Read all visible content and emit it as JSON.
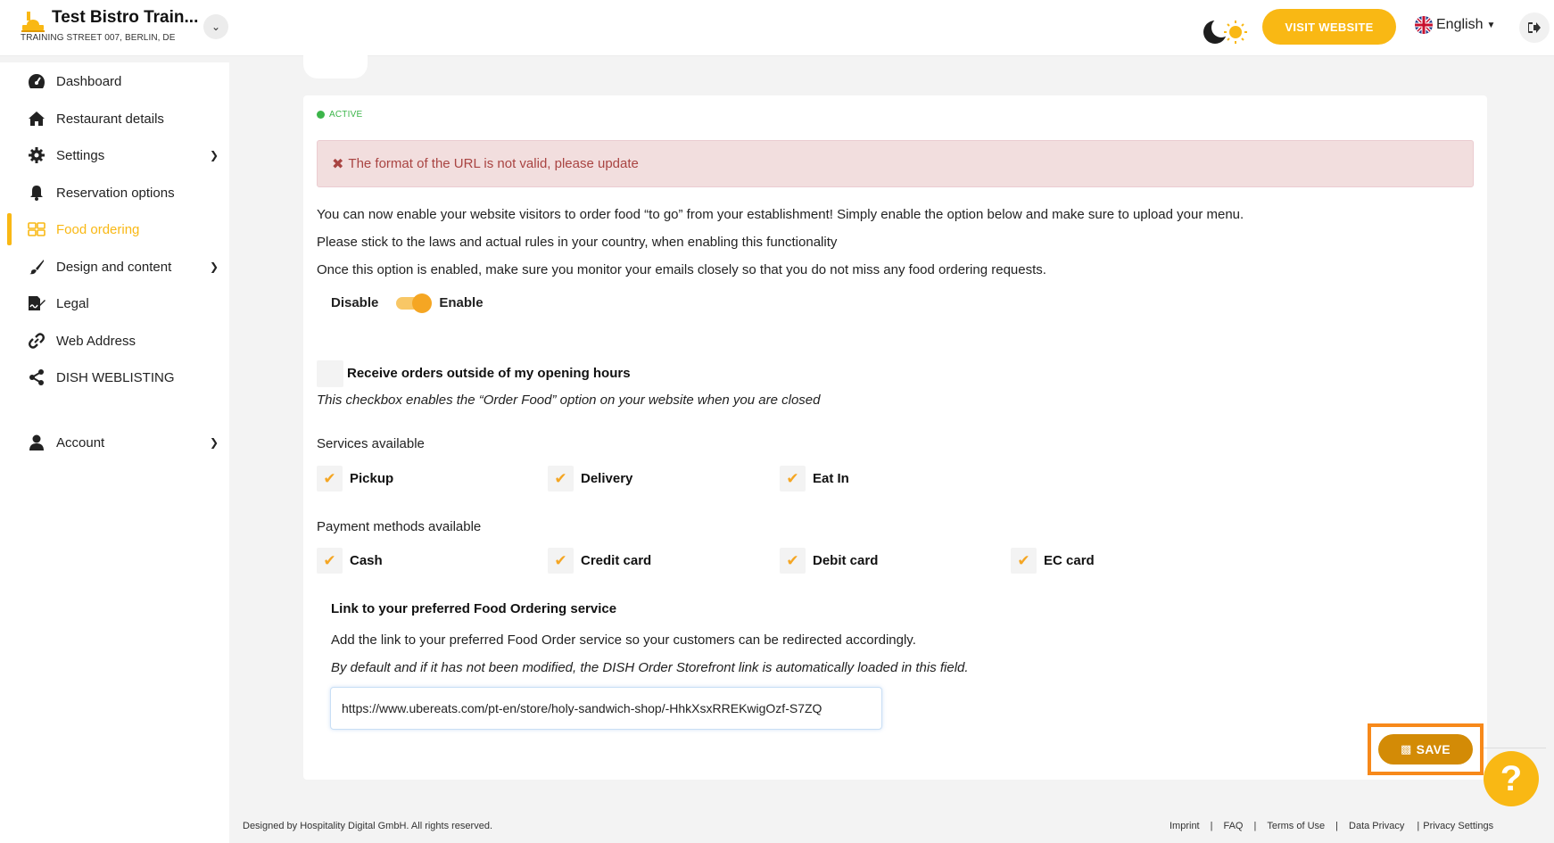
{
  "header": {
    "restaurant_name": "Test Bistro Train...",
    "restaurant_address": "TRAINING STREET 007, BERLIN, DE",
    "visit_website_label": "VISIT WEBSITE",
    "language_label": "English",
    "icons": {
      "brand": "chef-logo-icon",
      "theme": "moon-sun-icon",
      "flag": "uk-flag-icon",
      "logout": "logout-icon"
    }
  },
  "sidebar": {
    "items": [
      {
        "label": "Dashboard",
        "icon": "gauge-icon"
      },
      {
        "label": "Restaurant details",
        "icon": "home-icon"
      },
      {
        "label": "Settings",
        "icon": "gear-icon",
        "has_submenu": true
      },
      {
        "label": "Reservation options",
        "icon": "bell-icon"
      },
      {
        "label": "Food ordering",
        "icon": "food-icon",
        "active": true
      },
      {
        "label": "Design and content",
        "icon": "brush-icon",
        "has_submenu": true
      },
      {
        "label": "Legal",
        "icon": "document-sign-icon"
      },
      {
        "label": "Web Address",
        "icon": "link-icon"
      },
      {
        "label": "DISH WEBLISTING",
        "icon": "share-icon"
      },
      {
        "label": "Account",
        "icon": "user-icon",
        "has_submenu": true
      }
    ]
  },
  "main": {
    "status": "ACTIVE",
    "alert": "The format of the URL is not valid, please update",
    "intro_lines": [
      "You can now enable your website visitors to order food “to go” from your establishment! Simply enable the option below and make sure to upload your menu.",
      "Please stick to the laws and actual rules in your country, when enabling this functionality",
      "Once this option is enabled, make sure you monitor your emails closely so that you do not miss any food ordering requests."
    ],
    "toggle": {
      "off_label": "Disable",
      "on_label": "Enable",
      "value": "Enable"
    },
    "outside_hours": {
      "label": "Receive orders outside of my opening hours",
      "note": "This checkbox enables the “Order Food” option on your website when you are closed",
      "checked": false
    },
    "services": {
      "title": "Services available",
      "options": [
        {
          "label": "Pickup",
          "checked": true
        },
        {
          "label": "Delivery",
          "checked": true
        },
        {
          "label": "Eat In",
          "checked": true
        }
      ]
    },
    "payments": {
      "title": "Payment methods available",
      "options": [
        {
          "label": "Cash",
          "checked": true
        },
        {
          "label": "Credit card",
          "checked": true
        },
        {
          "label": "Debit card",
          "checked": true
        },
        {
          "label": "EC card",
          "checked": true
        }
      ]
    },
    "link_section": {
      "title": "Link to your preferred Food Ordering service",
      "description": "Add the link to your preferred Food Order service so your customers can be redirected accordingly.",
      "note": "By default and if it has not been modified, the DISH Order Storefront link is automatically loaded in this field.",
      "url_value": "https://www.ubereats.com/pt-en/store/holy-sandwich-shop/-HhkXsxRREKwigOzf-S7ZQ"
    },
    "save_label": "SAVE"
  },
  "footer": {
    "copyright": "Designed by Hospitality Digital GmbH. All rights reserved.",
    "links": [
      "Imprint",
      "FAQ",
      "Terms of Use",
      "Data Privacy",
      "Privacy Settings"
    ]
  },
  "colors": {
    "accent": "#f9b814",
    "save": "#d38b06",
    "highlight": "#f7891a",
    "active_status": "#3cb54a",
    "alert_text": "#a94442",
    "alert_bg": "#f2dede"
  }
}
